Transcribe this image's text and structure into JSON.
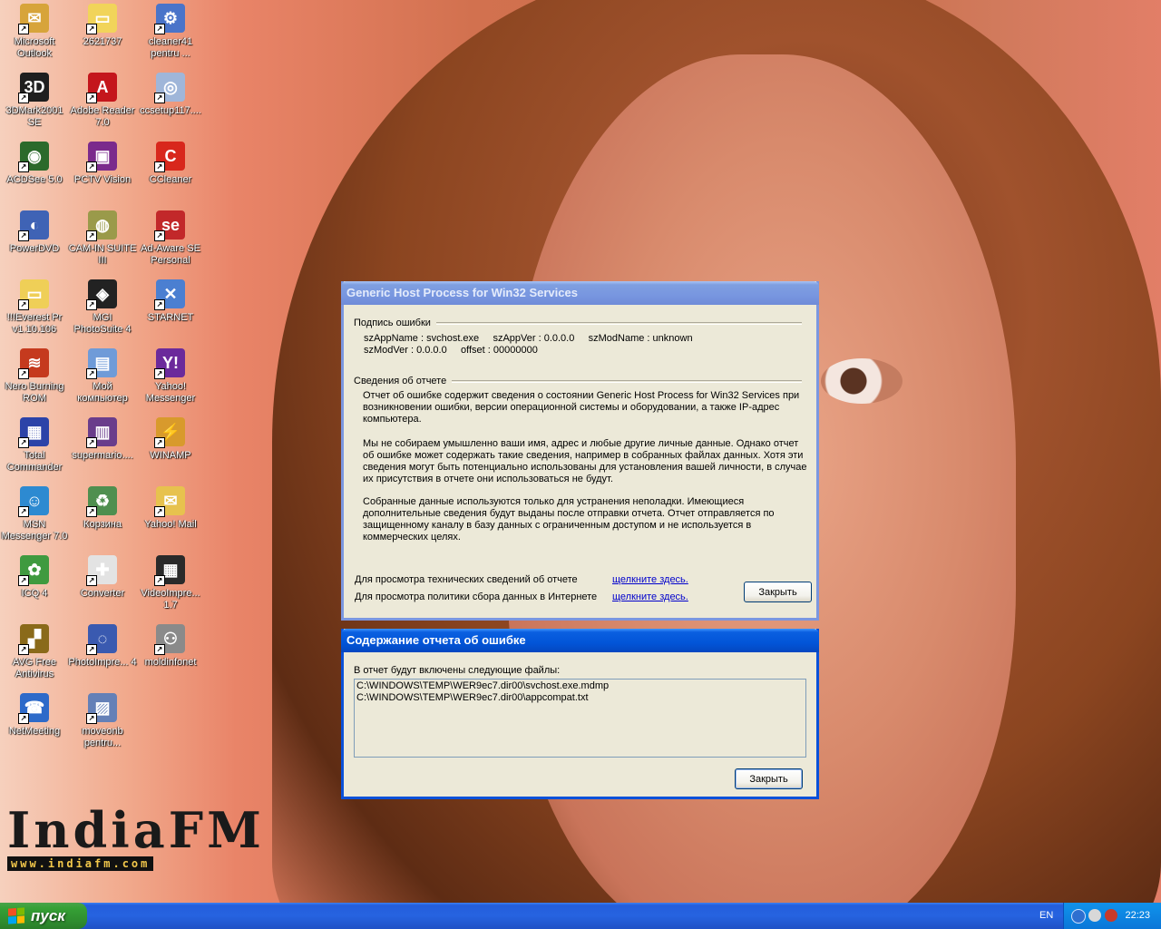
{
  "desktop": {
    "logo": {
      "big": "IndiaFM",
      "url": "www.indiafm.com"
    },
    "icons": [
      {
        "label": "Microsoft Outlook",
        "color": "#d7a43a",
        "glyph": "✉"
      },
      {
        "label": "2621737",
        "color": "#f1d45a",
        "glyph": "▭"
      },
      {
        "label": "cleaner41 pentru ...",
        "color": "#4a74c9",
        "glyph": "⚙"
      },
      {
        "label": "3DMark2001 SE",
        "color": "#1f1f1f",
        "glyph": "3D"
      },
      {
        "label": "Adobe Reader 7.0",
        "color": "#c4161c",
        "glyph": "A"
      },
      {
        "label": "ccsetup117....",
        "color": "#9fb6d9",
        "glyph": "◎"
      },
      {
        "label": "ACDSee 5.0",
        "color": "#2b6a2b",
        "glyph": "◉"
      },
      {
        "label": "PCTV Vision",
        "color": "#7b2a8c",
        "glyph": "▣"
      },
      {
        "label": "CCleaner",
        "color": "#d8271c",
        "glyph": "C"
      },
      {
        "label": "PowerDVD",
        "color": "#3f63b5",
        "glyph": "◐"
      },
      {
        "label": "CAM-IN SUITE III",
        "color": "#9a9a4a",
        "glyph": "◍"
      },
      {
        "label": "Ad-Aware SE Personal",
        "color": "#c2282a",
        "glyph": "se"
      },
      {
        "label": "!!!Everest Pr v1.10.106",
        "color": "#efcf57",
        "glyph": "▭"
      },
      {
        "label": "MGI PhotoSuite 4",
        "color": "#222222",
        "glyph": "◈"
      },
      {
        "label": "STARNET",
        "color": "#4b7fd1",
        "glyph": "✕"
      },
      {
        "label": "Nero Burning ROM",
        "color": "#c53a1e",
        "glyph": "≋"
      },
      {
        "label": "Мой компьютер",
        "color": "#6f9bd8",
        "glyph": "▤"
      },
      {
        "label": "Yahoo! Messenger",
        "color": "#6b2a9b",
        "glyph": "Y!"
      },
      {
        "label": "Total Commander",
        "color": "#2c43a8",
        "glyph": "▦"
      },
      {
        "label": "supermario....",
        "color": "#6a3d8b",
        "glyph": "▥"
      },
      {
        "label": "WINAMP",
        "color": "#d89a2c",
        "glyph": "⚡"
      },
      {
        "label": "MSN Messenger 7.0",
        "color": "#2d8ad1",
        "glyph": "☺"
      },
      {
        "label": "Корзина",
        "color": "#4f8f4f",
        "glyph": "♻"
      },
      {
        "label": "Yahoo! Mail",
        "color": "#e7c24e",
        "glyph": "✉"
      },
      {
        "label": "ICQ 4",
        "color": "#3f9a3f",
        "glyph": "✿"
      },
      {
        "label": "Converter",
        "color": "#e3e3e3",
        "glyph": "✚"
      },
      {
        "label": "VideoImpre... 1.7",
        "color": "#2a2a2a",
        "glyph": "▦"
      },
      {
        "label": "AVG Free Antivirus",
        "color": "#8a6a1a",
        "glyph": "▞"
      },
      {
        "label": "PhotoImpre... 4",
        "color": "#3a5ab0",
        "glyph": "◌"
      },
      {
        "label": "moldinfonet",
        "color": "#8a8a8a",
        "glyph": "⚇"
      },
      {
        "label": "NetMeeting",
        "color": "#2d6ac9",
        "glyph": "☎"
      },
      {
        "label": "moveonb pentru...",
        "color": "#6480b7",
        "glyph": "▨"
      }
    ]
  },
  "error_window": {
    "title": "Generic Host Process for Win32 Services",
    "signature_heading": "Подпись ошибки",
    "sig_line1": "szAppName : svchost.exe     szAppVer : 0.0.0.0     szModName : unknown",
    "sig_line2": "szModVer : 0.0.0.0     offset : 00000000",
    "report_heading": "Сведения об отчете",
    "para1": "Отчет об ошибке содержит сведения о состоянии Generic Host Process for Win32 Services при возникновении ошибки, версии операционной системы и оборудовании, а также IP-адрес компьютера.",
    "para2": "Мы не собираем умышленно ваши имя, адрес и любые другие личные данные. Однако отчет об ошибке может содержать такие сведения, например в собранных файлах данных. Хотя эти сведения могут быть потенциально использованы для установления вашей личности, в случае их присутствия в отчете они использоваться не будут.",
    "para3": "Собранные данные используются только для устранения неполадки. Имеющиеся дополнительные сведения будут выданы после отправки отчета. Отчет отправляется по защищенному каналу в базу данных с ограниченным доступом и не используется в коммерческих целях.",
    "tech_label": "Для просмотра технических сведений об отчете",
    "policy_label": "Для просмотра политики сбора данных в Интернете",
    "link_text": "щелкните здесь.",
    "close_label": "Закрыть"
  },
  "contents_window": {
    "title": "Содержание отчета об ошибке",
    "intro": "В отчет будут включены следующие файлы:",
    "files": [
      "C:\\WINDOWS\\TEMP\\WER9ec7.dir00\\svchost.exe.mdmp",
      "C:\\WINDOWS\\TEMP\\WER9ec7.dir00\\appcompat.txt"
    ],
    "close_label": "Закрыть"
  },
  "taskbar": {
    "start_label": "пуск",
    "language": "EN",
    "clock": "22:23"
  }
}
